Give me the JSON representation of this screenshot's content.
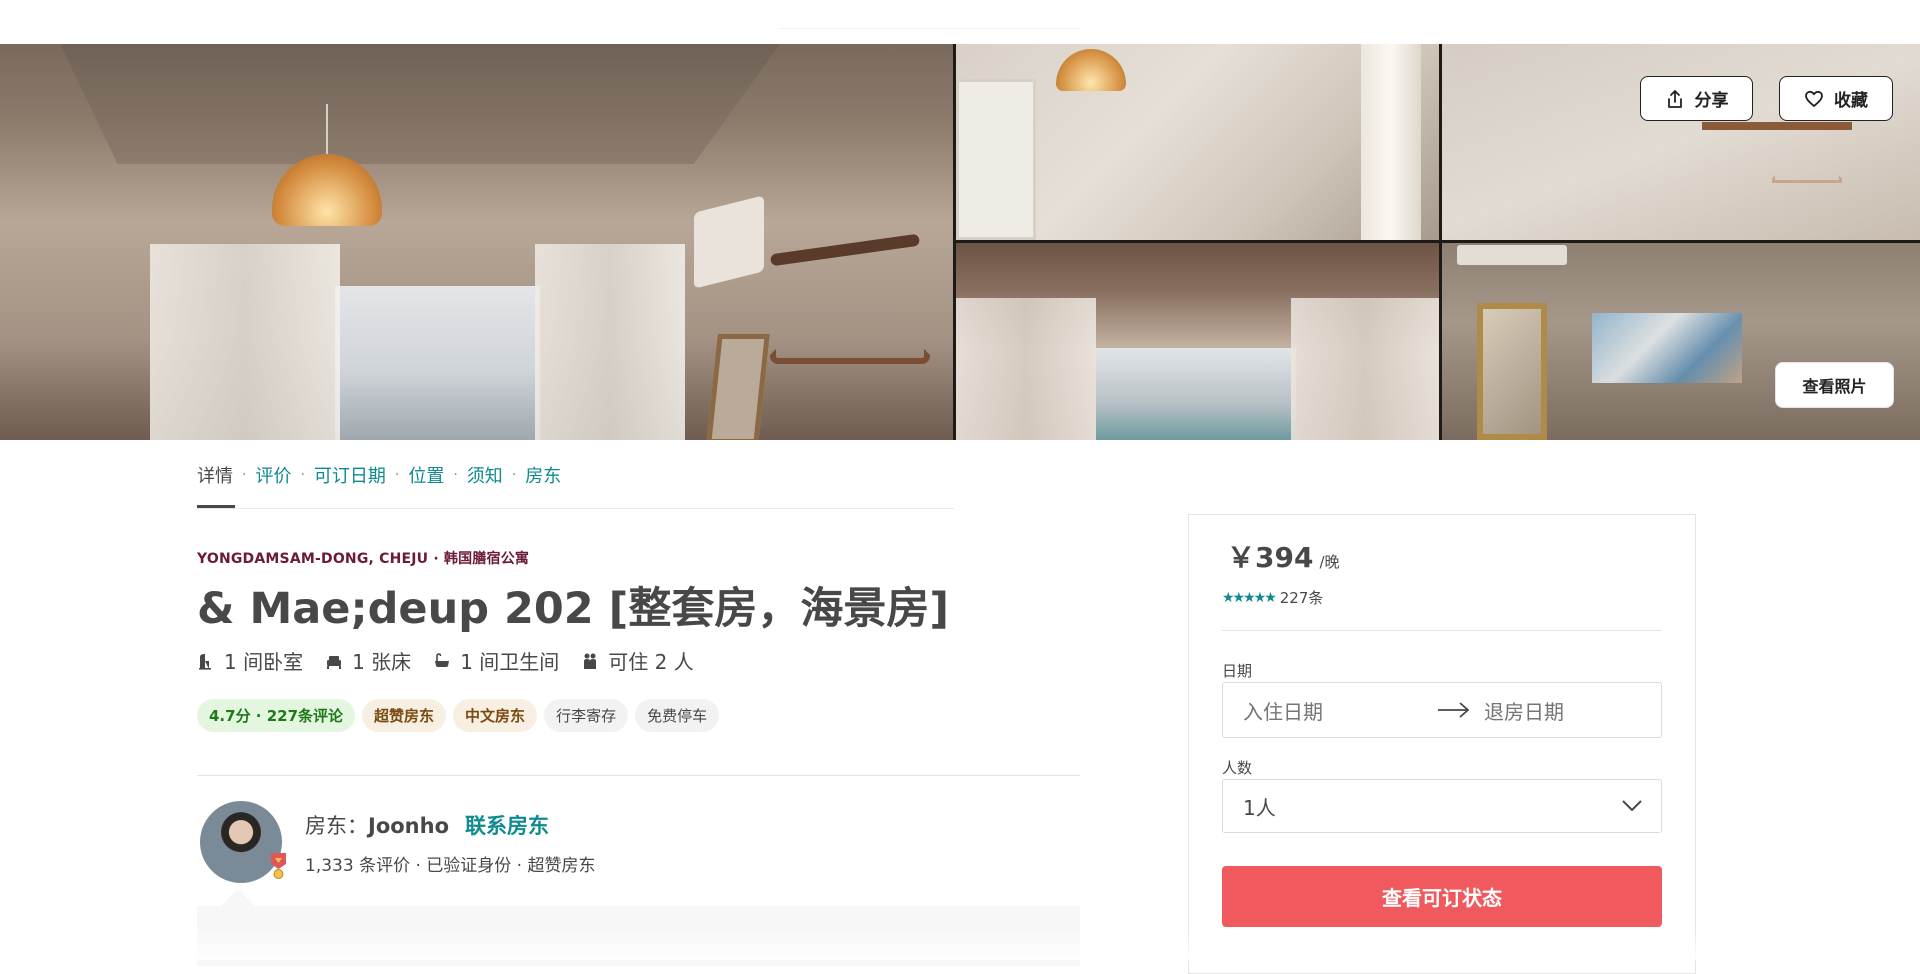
{
  "gallery": {
    "share_label": "分享",
    "save_label": "收藏",
    "view_photos_label": "查看照片",
    "icons": {
      "share": "share-icon",
      "save": "heart-icon"
    }
  },
  "subnav": {
    "items": [
      {
        "label": "详情",
        "active": true
      },
      {
        "label": "评价"
      },
      {
        "label": "可订日期"
      },
      {
        "label": "位置"
      },
      {
        "label": "须知"
      },
      {
        "label": "房东"
      }
    ],
    "separator": "·"
  },
  "listing": {
    "location": "YONGDAMSAM-DONG, CHEJU · 韩国膳宿公寓",
    "title": "& Mae;deup 202 [整套房，海景房]",
    "facts": [
      {
        "icon": "bedroom-icon",
        "label": "1 间卧室"
      },
      {
        "icon": "bed-icon",
        "label": "1 张床"
      },
      {
        "icon": "bathtub-icon",
        "label": "1 间卫生间"
      },
      {
        "icon": "guests-icon",
        "label": "可住 2 人"
      }
    ],
    "tags": [
      {
        "label": "4.7分 · 227条评论",
        "style": "green"
      },
      {
        "label": "超赞房东",
        "style": "gold"
      },
      {
        "label": "中文房东",
        "style": "gold"
      },
      {
        "label": "行李寄存",
        "style": "plain"
      },
      {
        "label": "免费停车",
        "style": "plain"
      }
    ]
  },
  "host": {
    "prefix": "房东：",
    "name": "Joonho",
    "contact_label": "联系房东",
    "subtitle": "1,333 条评价 · 已验证身份 · 超赞房东"
  },
  "booking": {
    "price": "￥394",
    "price_unit": "/晚",
    "stars": "★★★★★",
    "rating_value": 4.7,
    "review_count": "227条",
    "dates_label": "日期",
    "checkin_placeholder": "入住日期",
    "checkout_placeholder": "退房日期",
    "guests_label": "人数",
    "guests_value": "1人",
    "cta_label": "查看可订状态",
    "accent": "#f05a5f",
    "link_color": "#0f8a8f"
  }
}
